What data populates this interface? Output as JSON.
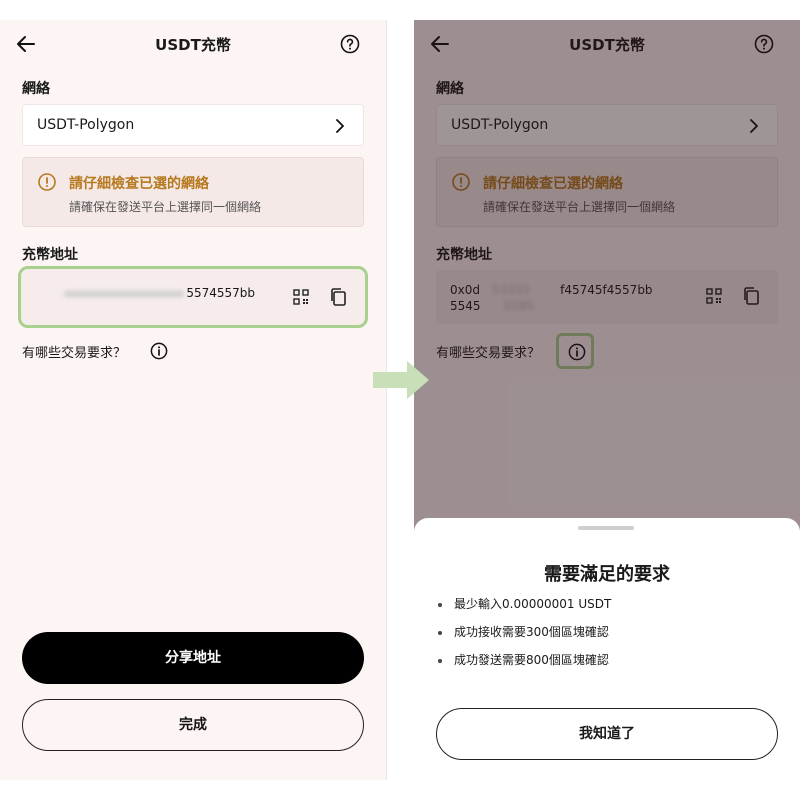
{
  "left": {
    "title": "USDT充幣",
    "network_label": "網絡",
    "network_value": "USDT-Polygon",
    "warning_title": "請仔細檢查已選的網絡",
    "warning_sub": "請確保在發送平台上選擇同一個網絡",
    "address_label": "充幣地址",
    "address_suffix": "5574557bb",
    "requirements_link": "有哪些交易要求？",
    "share_button": "分享地址",
    "done_button": "完成"
  },
  "right": {
    "title": "USDT充幣",
    "network_label": "網絡",
    "network_value": "USDT-Polygon",
    "warning_title": "請仔細檢查已選的網絡",
    "warning_sub": "請確保在發送平台上選擇同一個網絡",
    "address_label": "充幣地址",
    "address_line1_a": "0x0d",
    "address_line1_b": "53333",
    "address_line1_c": "f45745f4557bb",
    "address_line2_a": "5545",
    "address_line2_b": "5585",
    "requirements_link": "有哪些交易要求？",
    "sheet_title": "需要滿足的要求",
    "sheet_items": [
      "最少輸入0.00000001 USDT",
      "成功接收需要300個區塊確認",
      "成功發送需要800個區塊確認"
    ],
    "sheet_button": "我知道了"
  },
  "colors": {
    "highlight": "#a9d08e",
    "warning_text": "#b7791f",
    "overlay": "rgba(40,20,25,0.45)"
  }
}
